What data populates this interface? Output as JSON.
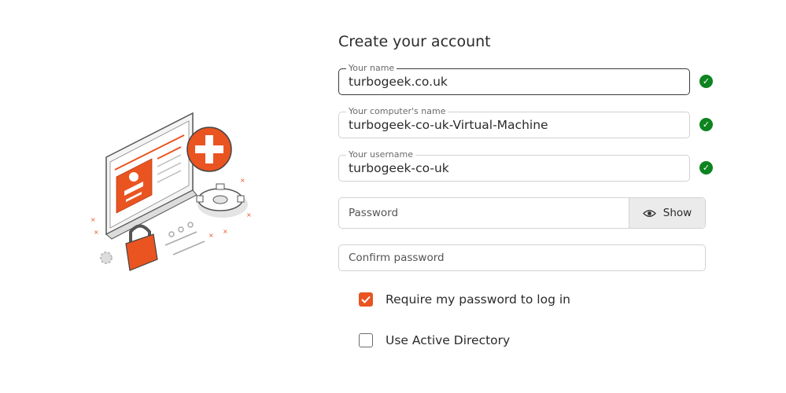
{
  "form": {
    "title": "Create your account",
    "name": {
      "label": "Your name",
      "value": "turbogeek.co.uk",
      "valid": true
    },
    "computer_name": {
      "label": "Your computer's name",
      "value": "turbogeek-co-uk-Virtual-Machine",
      "valid": true
    },
    "username": {
      "label": "Your username",
      "value": "turbogeek-co-uk",
      "valid": true
    },
    "password": {
      "placeholder": "Password",
      "show_label": "Show"
    },
    "confirm_password": {
      "placeholder": "Confirm password"
    },
    "require_password": {
      "label": "Require my password to log in",
      "checked": true
    },
    "active_directory": {
      "label": "Use Active Directory",
      "checked": false
    }
  },
  "icons": {
    "valid": "check-circle-icon",
    "show": "eye-icon",
    "checkbox": "checkmark-icon"
  },
  "colors": {
    "accent": "#e95420",
    "success": "#0e8420",
    "focus_border": "#3a3a3a",
    "border": "#d2d2d2"
  }
}
